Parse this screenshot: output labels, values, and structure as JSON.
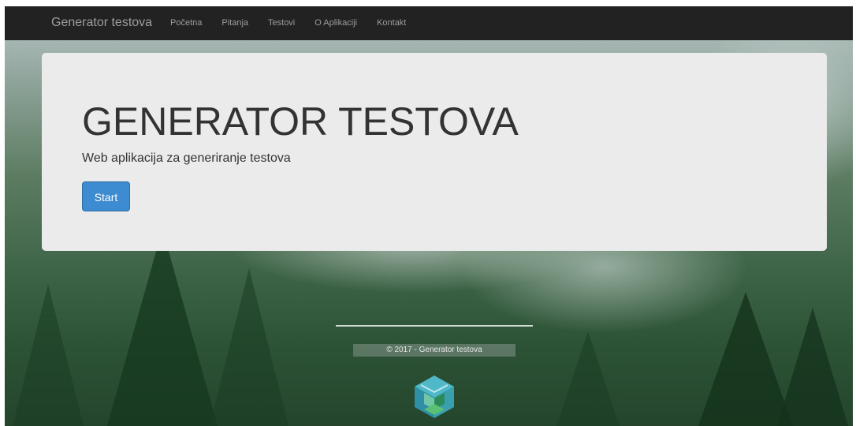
{
  "navbar": {
    "brand": "Generator testova",
    "items": [
      "Početna",
      "Pitanja",
      "Testovi",
      "O Aplikaciji",
      "Kontakt"
    ]
  },
  "hero": {
    "title": "GENERATOR TESTOVA",
    "subtitle": "Web aplikacija za generiranje testova",
    "start_label": "Start"
  },
  "footer": {
    "copyright": "© 2017 - Generator testova"
  },
  "colors": {
    "navbar_bg": "#222222",
    "jumbotron_bg": "#ebebeb",
    "primary_button": "#3d8bd0"
  },
  "icons": {
    "footer_logo": "cube-logo-icon"
  }
}
